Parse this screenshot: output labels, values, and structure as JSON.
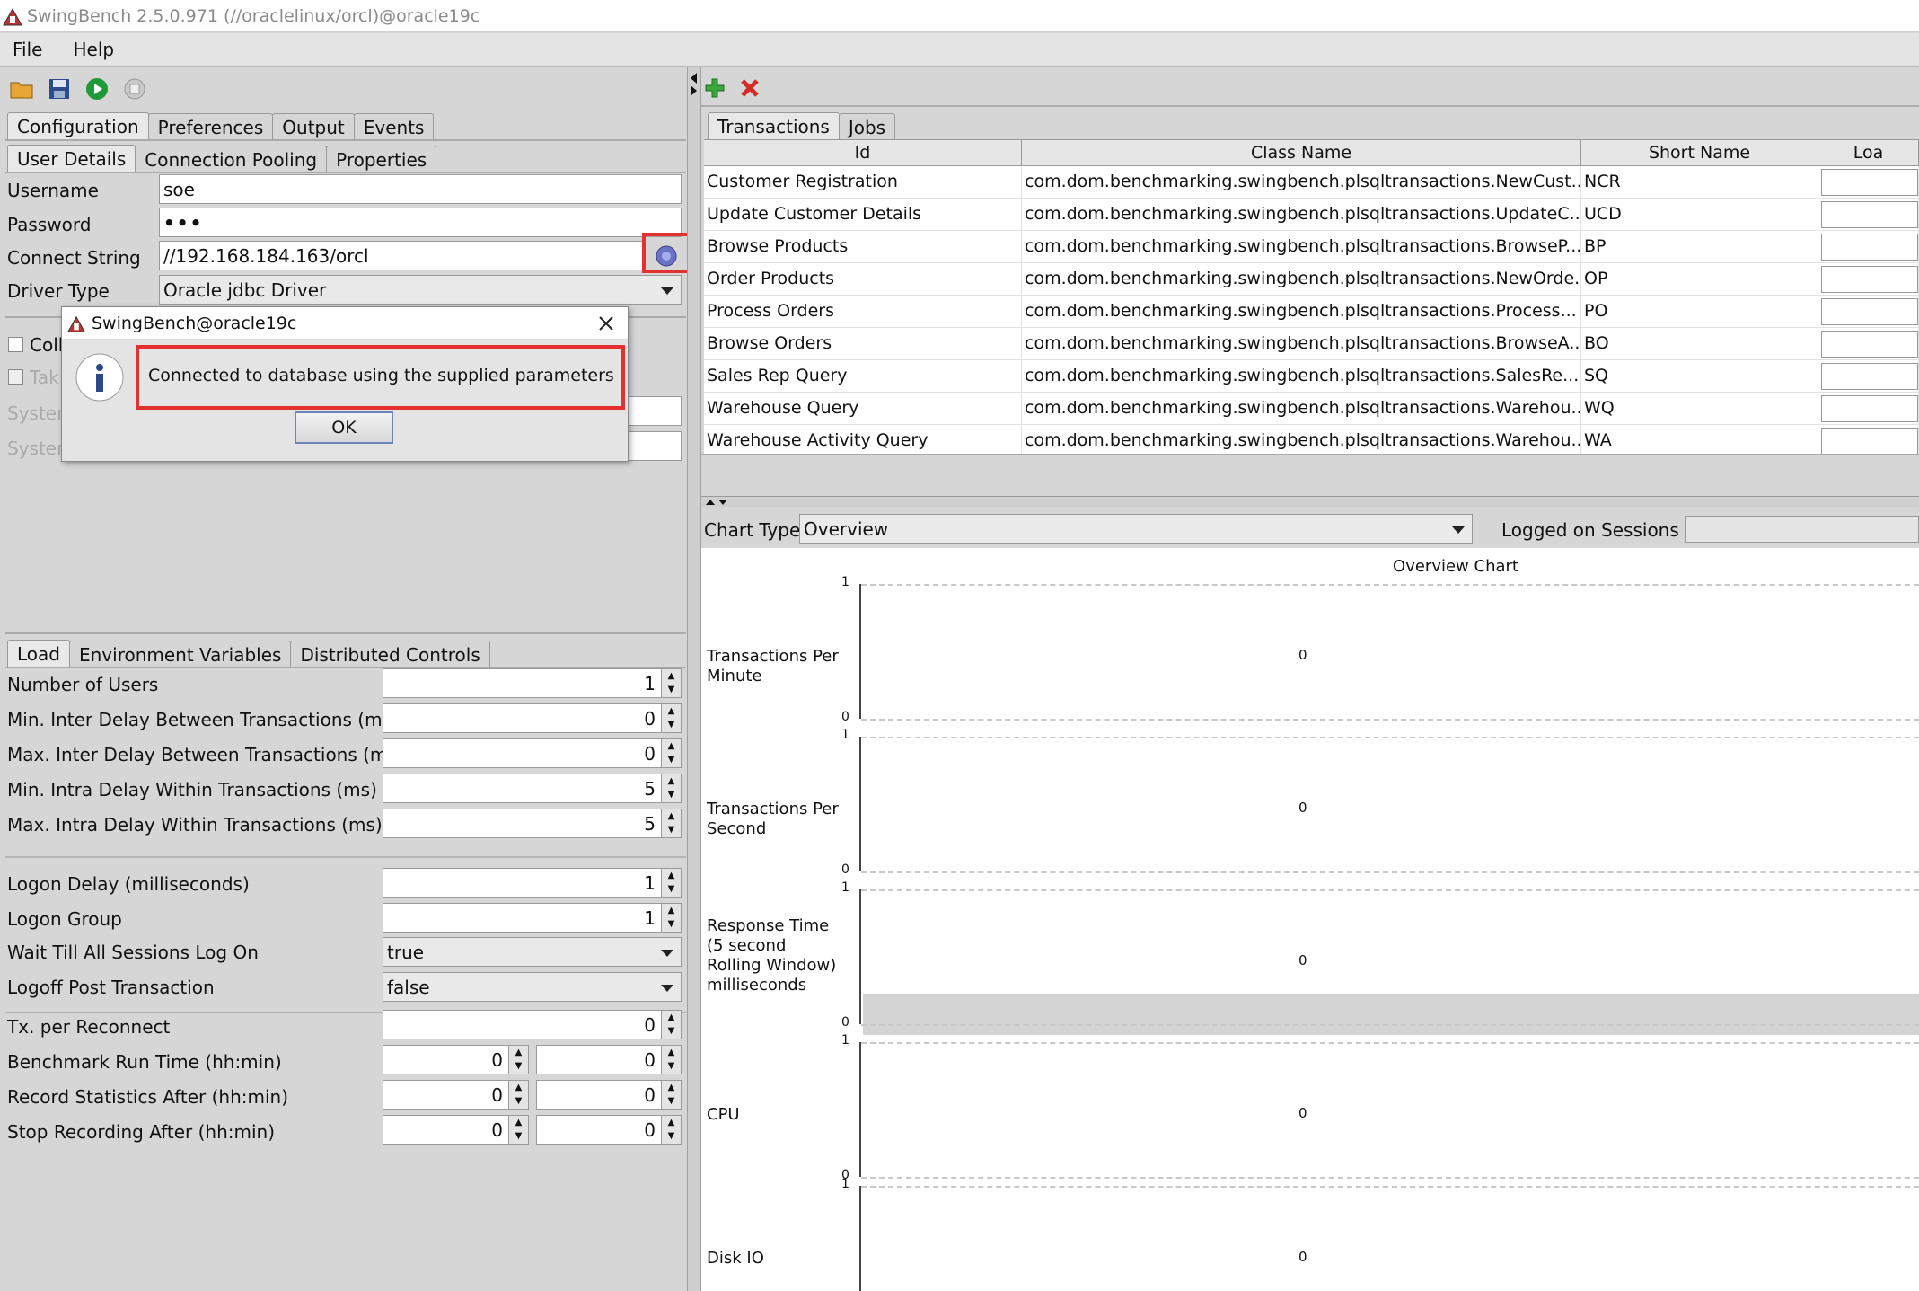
{
  "window": {
    "title": "SwingBench 2.5.0.971  (//oraclelinux/orcl)@oracle19c"
  },
  "menu": {
    "items": [
      "File",
      "Help"
    ]
  },
  "toolbar": {
    "icons": [
      "open-folder-icon",
      "save-disk-icon",
      "run-play-icon",
      "stop-icon"
    ]
  },
  "config_tabs": [
    "Configuration",
    "Preferences",
    "Output",
    "Events"
  ],
  "sub_tabs": [
    "User Details",
    "Connection Pooling",
    "Properties"
  ],
  "user_details": {
    "username_label": "Username",
    "username": "soe",
    "password_label": "Password",
    "password": "•••",
    "connect_label": "Connect String",
    "connect": "//192.168.184.163/orcl",
    "driver_label": "Driver Type",
    "driver": "Oracle jdbc Driver",
    "collect_label": "Coll",
    "take_label": "Tak",
    "sys1_label": "System",
    "sys2_label": "System"
  },
  "load_tabs": [
    "Load",
    "Environment Variables",
    "Distributed Controls"
  ],
  "load": {
    "rows": [
      {
        "label": "Number of Users",
        "value": "1"
      },
      {
        "label": "Min. Inter Delay Between Transactions (ms)",
        "value": "0"
      },
      {
        "label": "Max. Inter Delay Between Transactions (ms)",
        "value": "0"
      },
      {
        "label": "Min. Intra Delay Within Transactions (ms)",
        "value": "5"
      },
      {
        "label": "Max. Intra Delay Within Transactions (ms)",
        "value": "5"
      }
    ],
    "logon_delay_label": "Logon Delay (milliseconds)",
    "logon_delay": "1",
    "logon_group_label": "Logon Group",
    "logon_group": "1",
    "wait_label": "Wait Till All Sessions Log On",
    "wait": "true",
    "logoff_label": "Logoff Post Transaction",
    "logoff": "false",
    "tx_label": "Tx. per Reconnect",
    "tx": "0",
    "run_label": "Benchmark Run Time (hh:min)",
    "run_h": "0",
    "run_m": "0",
    "rec_label": "Record Statistics After (hh:min)",
    "rec_h": "0",
    "rec_m": "0",
    "stop_label": "Stop Recording After (hh:min)",
    "stop_h": "0",
    "stop_m": "0"
  },
  "right_toolbar": {
    "icons": [
      "add-plus-icon",
      "delete-x-icon"
    ]
  },
  "tx_tabs": [
    "Transactions",
    "Jobs"
  ],
  "table": {
    "headers": [
      "Id",
      "Class Name",
      "Short Name",
      "Loa"
    ],
    "rows": [
      {
        "id": "Customer Registration",
        "cls": "com.dom.benchmarking.swingbench.plsqltransactions.NewCust...",
        "short": "NCR"
      },
      {
        "id": "Update Customer Details",
        "cls": "com.dom.benchmarking.swingbench.plsqltransactions.UpdateC...",
        "short": "UCD"
      },
      {
        "id": "Browse Products",
        "cls": "com.dom.benchmarking.swingbench.plsqltransactions.BrowseP...",
        "short": "BP"
      },
      {
        "id": "Order Products",
        "cls": "com.dom.benchmarking.swingbench.plsqltransactions.NewOrde...",
        "short": "OP"
      },
      {
        "id": "Process Orders",
        "cls": "com.dom.benchmarking.swingbench.plsqltransactions.Process...",
        "short": "PO"
      },
      {
        "id": "Browse Orders",
        "cls": "com.dom.benchmarking.swingbench.plsqltransactions.BrowseA...",
        "short": "BO"
      },
      {
        "id": "Sales Rep Query",
        "cls": "com.dom.benchmarking.swingbench.plsqltransactions.SalesRe...",
        "short": "SQ"
      },
      {
        "id": "Warehouse Query",
        "cls": "com.dom.benchmarking.swingbench.plsqltransactions.Warehou...",
        "short": "WQ"
      },
      {
        "id": "Warehouse Activity Query",
        "cls": "com.dom.benchmarking.swingbench.plsqltransactions.Warehou...",
        "short": "WA"
      }
    ]
  },
  "chart_controls": {
    "type_label": "Chart Type",
    "type_value": "Overview",
    "sessions_label": "Logged on Sessions"
  },
  "chart": {
    "title": "Overview Chart",
    "panels": [
      {
        "label": "Transactions Per Minute",
        "tick_top": "1",
        "tick_bottom": "0",
        "value": "0"
      },
      {
        "label": "Transactions Per Second",
        "tick_top": "1",
        "tick_bottom": "0",
        "value": "0"
      },
      {
        "label": "Response Time (5 second Rolling Window) milliseconds",
        "tick_top": "1",
        "tick_bottom": "0",
        "value": "0"
      },
      {
        "label": "CPU",
        "tick_top": "1",
        "tick_bottom": "0",
        "value": "0"
      },
      {
        "label": "Disk IO",
        "tick_top": "1",
        "tick_bottom": "",
        "value": "0"
      }
    ]
  },
  "dialog": {
    "title": "SwingBench@oracle19c",
    "message": "Connected to database using the supplied parameters",
    "ok": "OK"
  },
  "colors": {
    "highlight": "#e53030",
    "info_icon": "#2a4a8a"
  }
}
